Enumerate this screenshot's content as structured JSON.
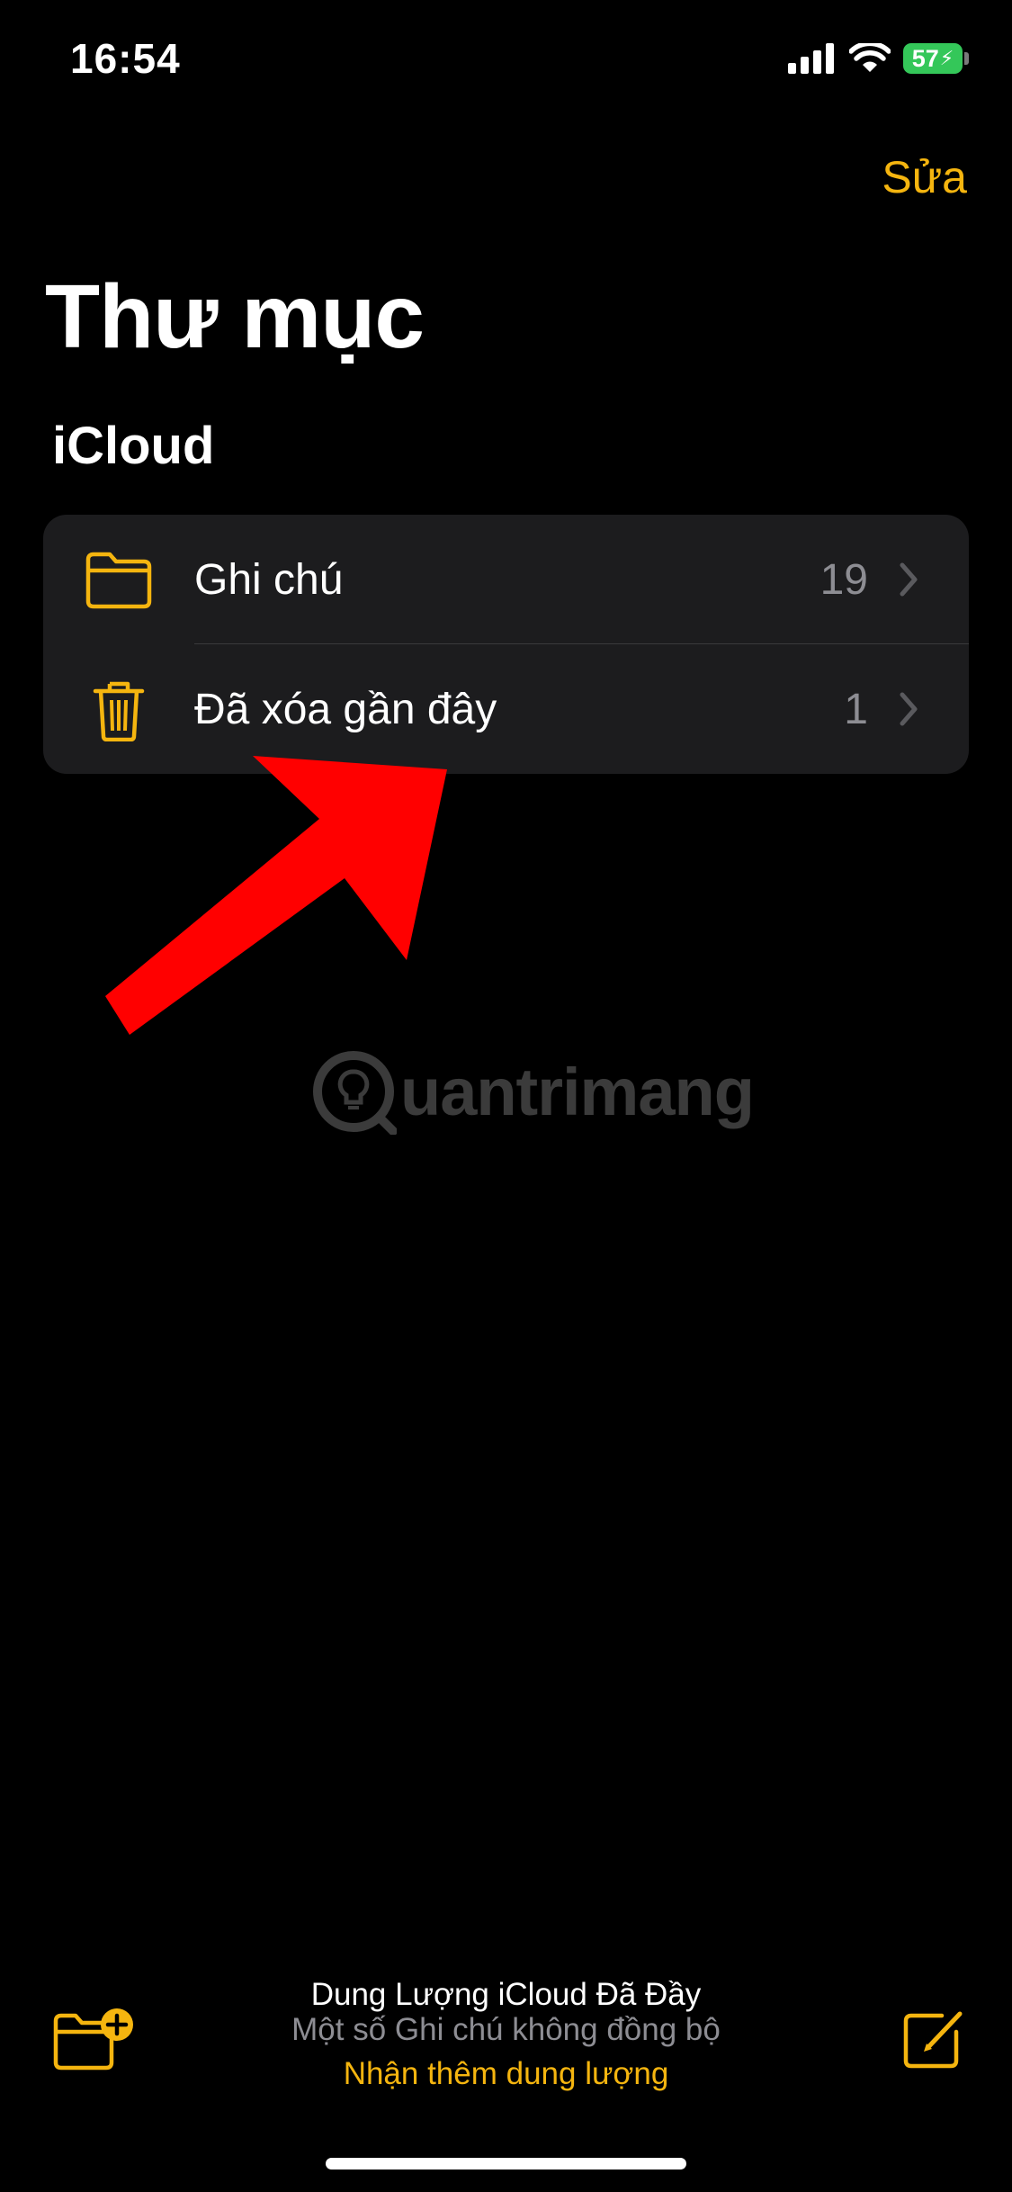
{
  "status_bar": {
    "time": "16:54",
    "battery_level": "57",
    "signal_icon": "cellular-signal-icon",
    "wifi_icon": "wifi-icon",
    "battery_icon": "battery-charging-icon"
  },
  "nav": {
    "edit_label": "Sửa"
  },
  "page": {
    "title": "Thư mục"
  },
  "sections": [
    {
      "header": "iCloud",
      "folders": [
        {
          "label": "Ghi chú",
          "count": "19",
          "icon": "folder-icon"
        },
        {
          "label": "Đã xóa gần đây",
          "count": "1",
          "icon": "trash-icon"
        }
      ]
    }
  ],
  "watermark": {
    "text": "uantrimang",
    "icon": "lightbulb-logo-icon"
  },
  "toolbar": {
    "storage_title": "Dung Lượng iCloud Đã Đầy",
    "storage_subtitle": "Một số Ghi chú không đồng bộ",
    "storage_link": "Nhận thêm dung lượng",
    "new_folder_icon": "new-folder-icon",
    "compose_icon": "compose-icon"
  },
  "colors": {
    "accent": "#f5b50f",
    "background": "#000000",
    "card": "#1c1c1e",
    "secondary_text": "#8d8d93",
    "annotation_arrow": "#ff0000",
    "battery": "#34c759"
  }
}
